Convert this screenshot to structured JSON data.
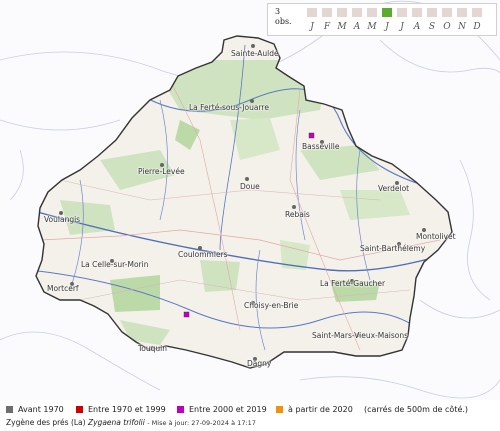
{
  "phenology": {
    "count": "3",
    "unit": "obs.",
    "months": [
      {
        "letter": "J",
        "active": false
      },
      {
        "letter": "F",
        "active": false
      },
      {
        "letter": "M",
        "active": false
      },
      {
        "letter": "A",
        "active": false
      },
      {
        "letter": "M",
        "active": false
      },
      {
        "letter": "J",
        "active": true
      },
      {
        "letter": "J",
        "active": false
      },
      {
        "letter": "A",
        "active": false
      },
      {
        "letter": "S",
        "active": false
      },
      {
        "letter": "O",
        "active": false
      },
      {
        "letter": "N",
        "active": false
      },
      {
        "letter": "D",
        "active": false
      }
    ],
    "active_color": "#5bab2f",
    "inactive_color": "#e3d6d3"
  },
  "map": {
    "places": [
      "Sainte-Aulde",
      "La Ferté-sous-Jouarre",
      "Basseville",
      "Pierre-Levée",
      "Doue",
      "Verdelot",
      "Rebais",
      "Voulangis",
      "Montolivet",
      "Saint-Barthélemy",
      "Coulommiers",
      "La Celle-sur-Morin",
      "La Ferté-Gaucher",
      "Mortcerf",
      "Choisy-en-Brie",
      "Saint-Mars-Vieux-Maisons",
      "Touquin",
      "Dagny"
    ],
    "observation_color": "#c000c0",
    "outline_color": "#333333"
  },
  "legend": {
    "items": [
      {
        "label": "Avant 1970",
        "color": "#6e6e6e"
      },
      {
        "label": "Entre 1970 et 1999",
        "color": "#d00000"
      },
      {
        "label": "Entre 2000 et 2019",
        "color": "#c000c0"
      },
      {
        "label": "à partir de 2020",
        "color": "#f0920a"
      }
    ],
    "note": "(carrés de 500m de côté.)"
  },
  "caption": {
    "common_name": "Zygène des prés (La)",
    "scientific_name": "Zygaena trifolii",
    "update": "- Mise à jour: 27-09-2024 à 17:17"
  }
}
